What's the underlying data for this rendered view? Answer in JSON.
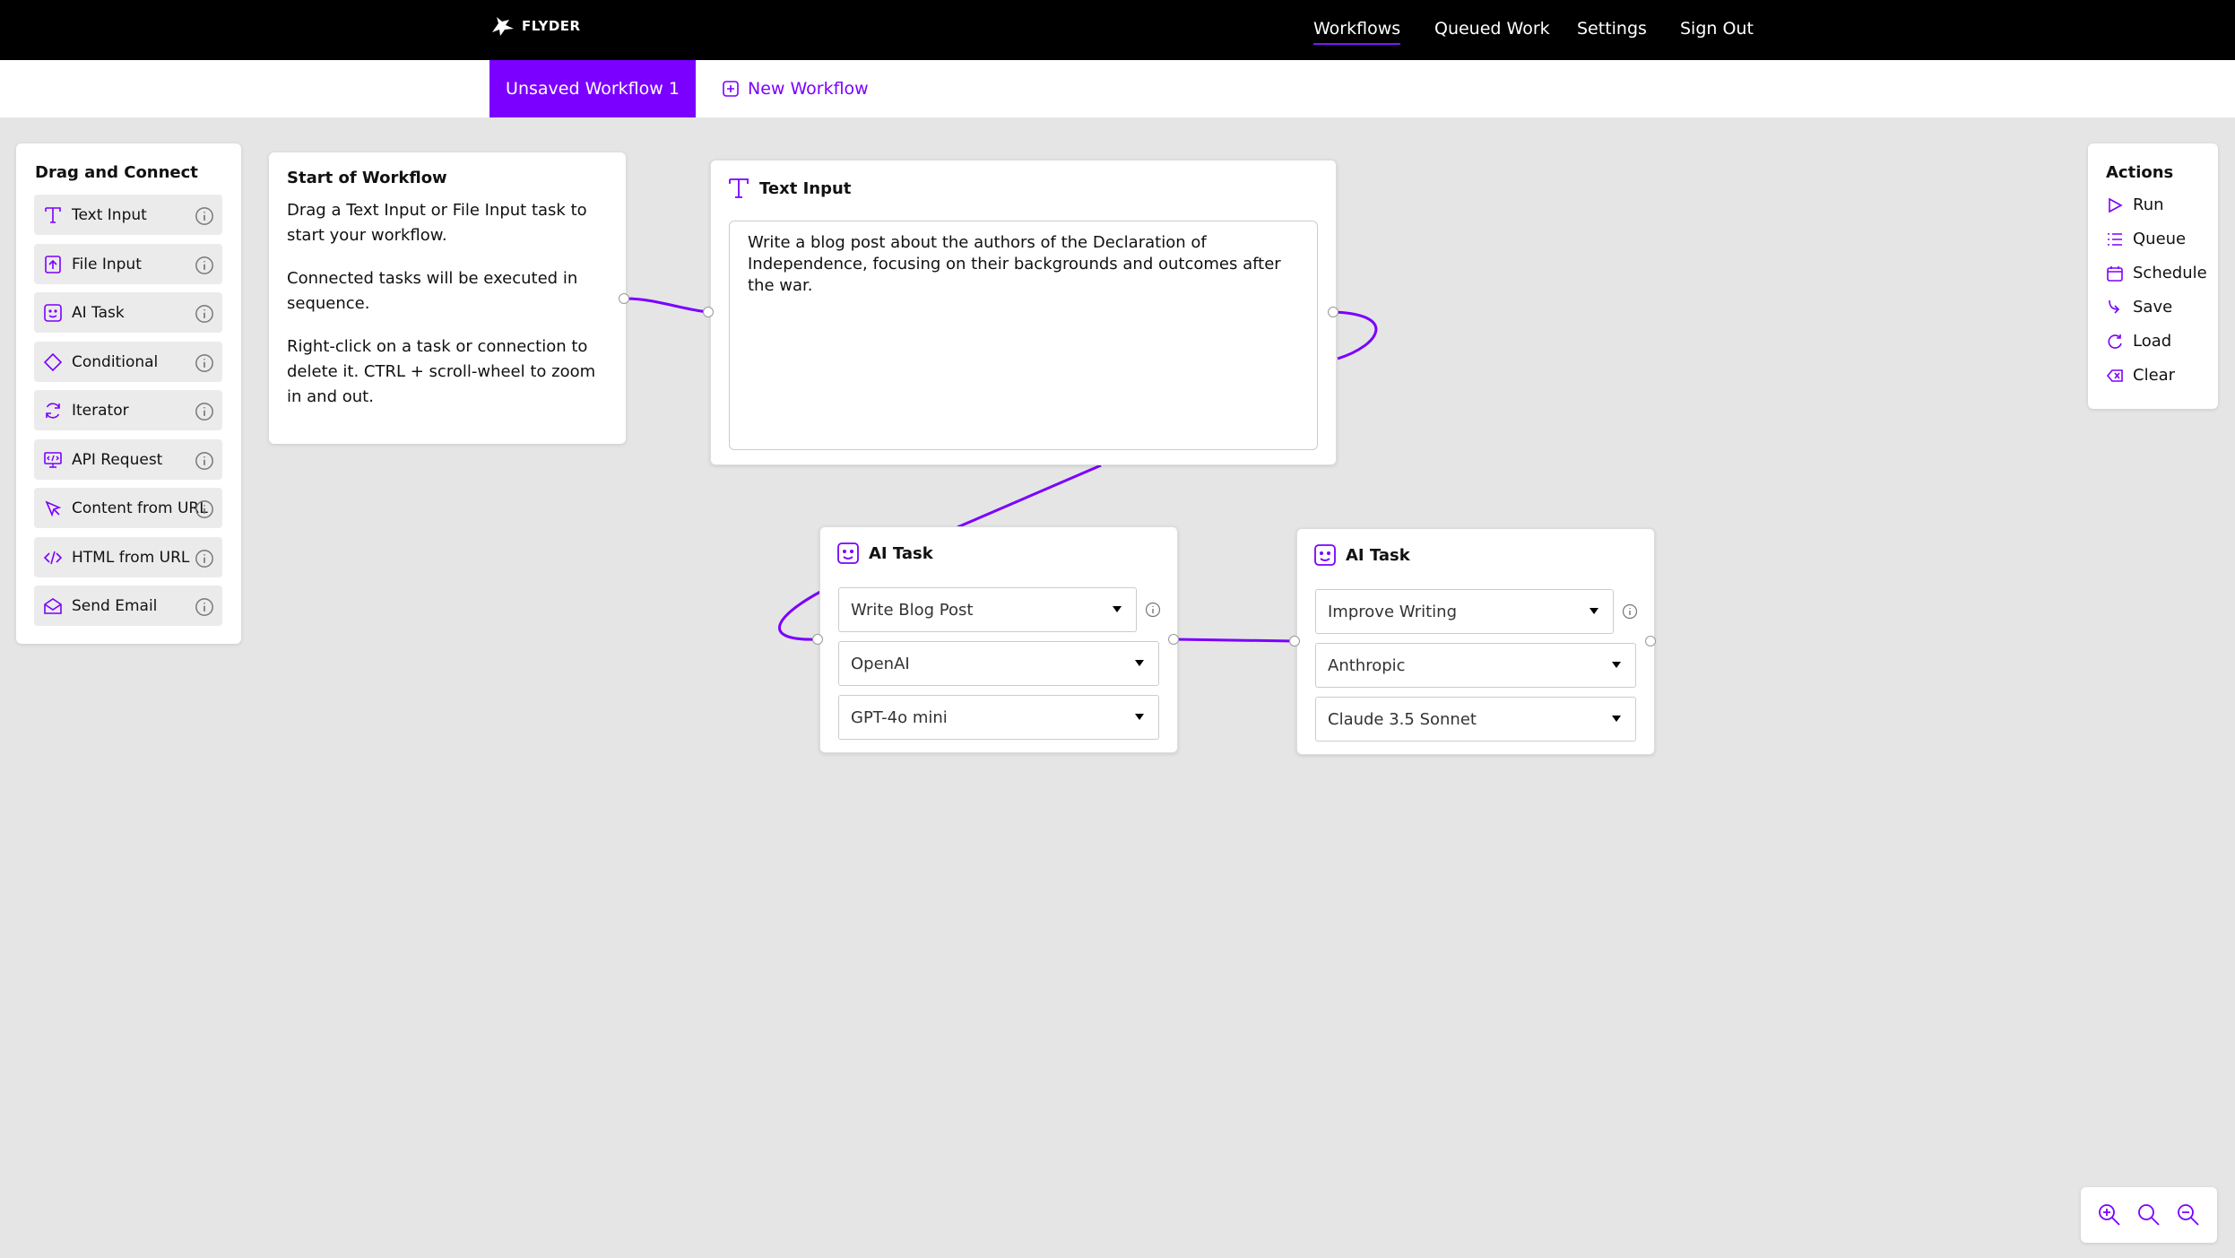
{
  "app": {
    "brand": "FLYDER",
    "accent": "#7b00ff",
    "nav": [
      {
        "label": "Workflows",
        "active": true
      },
      {
        "label": "Queued Work",
        "active": false
      },
      {
        "label": "Settings",
        "active": false
      },
      {
        "label": "Sign Out",
        "active": false
      }
    ]
  },
  "tabs": {
    "active": "Unsaved Workflow 1",
    "new": "New Workflow"
  },
  "palette": {
    "title": "Drag and Connect",
    "items": [
      {
        "label": "Text Input",
        "icon": "text-icon"
      },
      {
        "label": "File Input",
        "icon": "file-upload-icon"
      },
      {
        "label": "AI Task",
        "icon": "robot-icon"
      },
      {
        "label": "Conditional",
        "icon": "diamond-icon"
      },
      {
        "label": "Iterator",
        "icon": "loop-icon"
      },
      {
        "label": "API Request",
        "icon": "api-icon"
      },
      {
        "label": "Content from URL",
        "icon": "cursor-icon"
      },
      {
        "label": "HTML from URL",
        "icon": "code-icon"
      },
      {
        "label": "Send Email",
        "icon": "mail-icon"
      }
    ]
  },
  "start": {
    "title": "Start of Workflow",
    "p1": "Drag a Text Input or File Input task to start your workflow.",
    "p2": "Connected tasks will be executed in sequence.",
    "p3": "Right-click on a task or connection to delete it. CTRL + scroll-wheel to zoom in and out."
  },
  "text_input_node": {
    "title": "Text Input",
    "value": "Write a blog post about the authors of the Declaration of Independence, focusing on their backgrounds and outcomes after the war."
  },
  "ai_task_1": {
    "title": "AI Task",
    "task": "Write Blog Post",
    "provider": "OpenAI",
    "model": "GPT-4o mini"
  },
  "ai_task_2": {
    "title": "AI Task",
    "task": "Improve Writing",
    "provider": "Anthropic",
    "model": "Claude 3.5 Sonnet"
  },
  "actions": {
    "title": "Actions",
    "items": [
      {
        "label": "Run",
        "icon": "play-icon"
      },
      {
        "label": "Queue",
        "icon": "queue-icon"
      },
      {
        "label": "Schedule",
        "icon": "calendar-icon"
      },
      {
        "label": "Save",
        "icon": "save-icon"
      },
      {
        "label": "Load",
        "icon": "reload-icon"
      },
      {
        "label": "Clear",
        "icon": "clear-icon"
      }
    ]
  },
  "zoom": [
    "zoom-in-icon",
    "zoom-reset-icon",
    "zoom-out-icon"
  ]
}
